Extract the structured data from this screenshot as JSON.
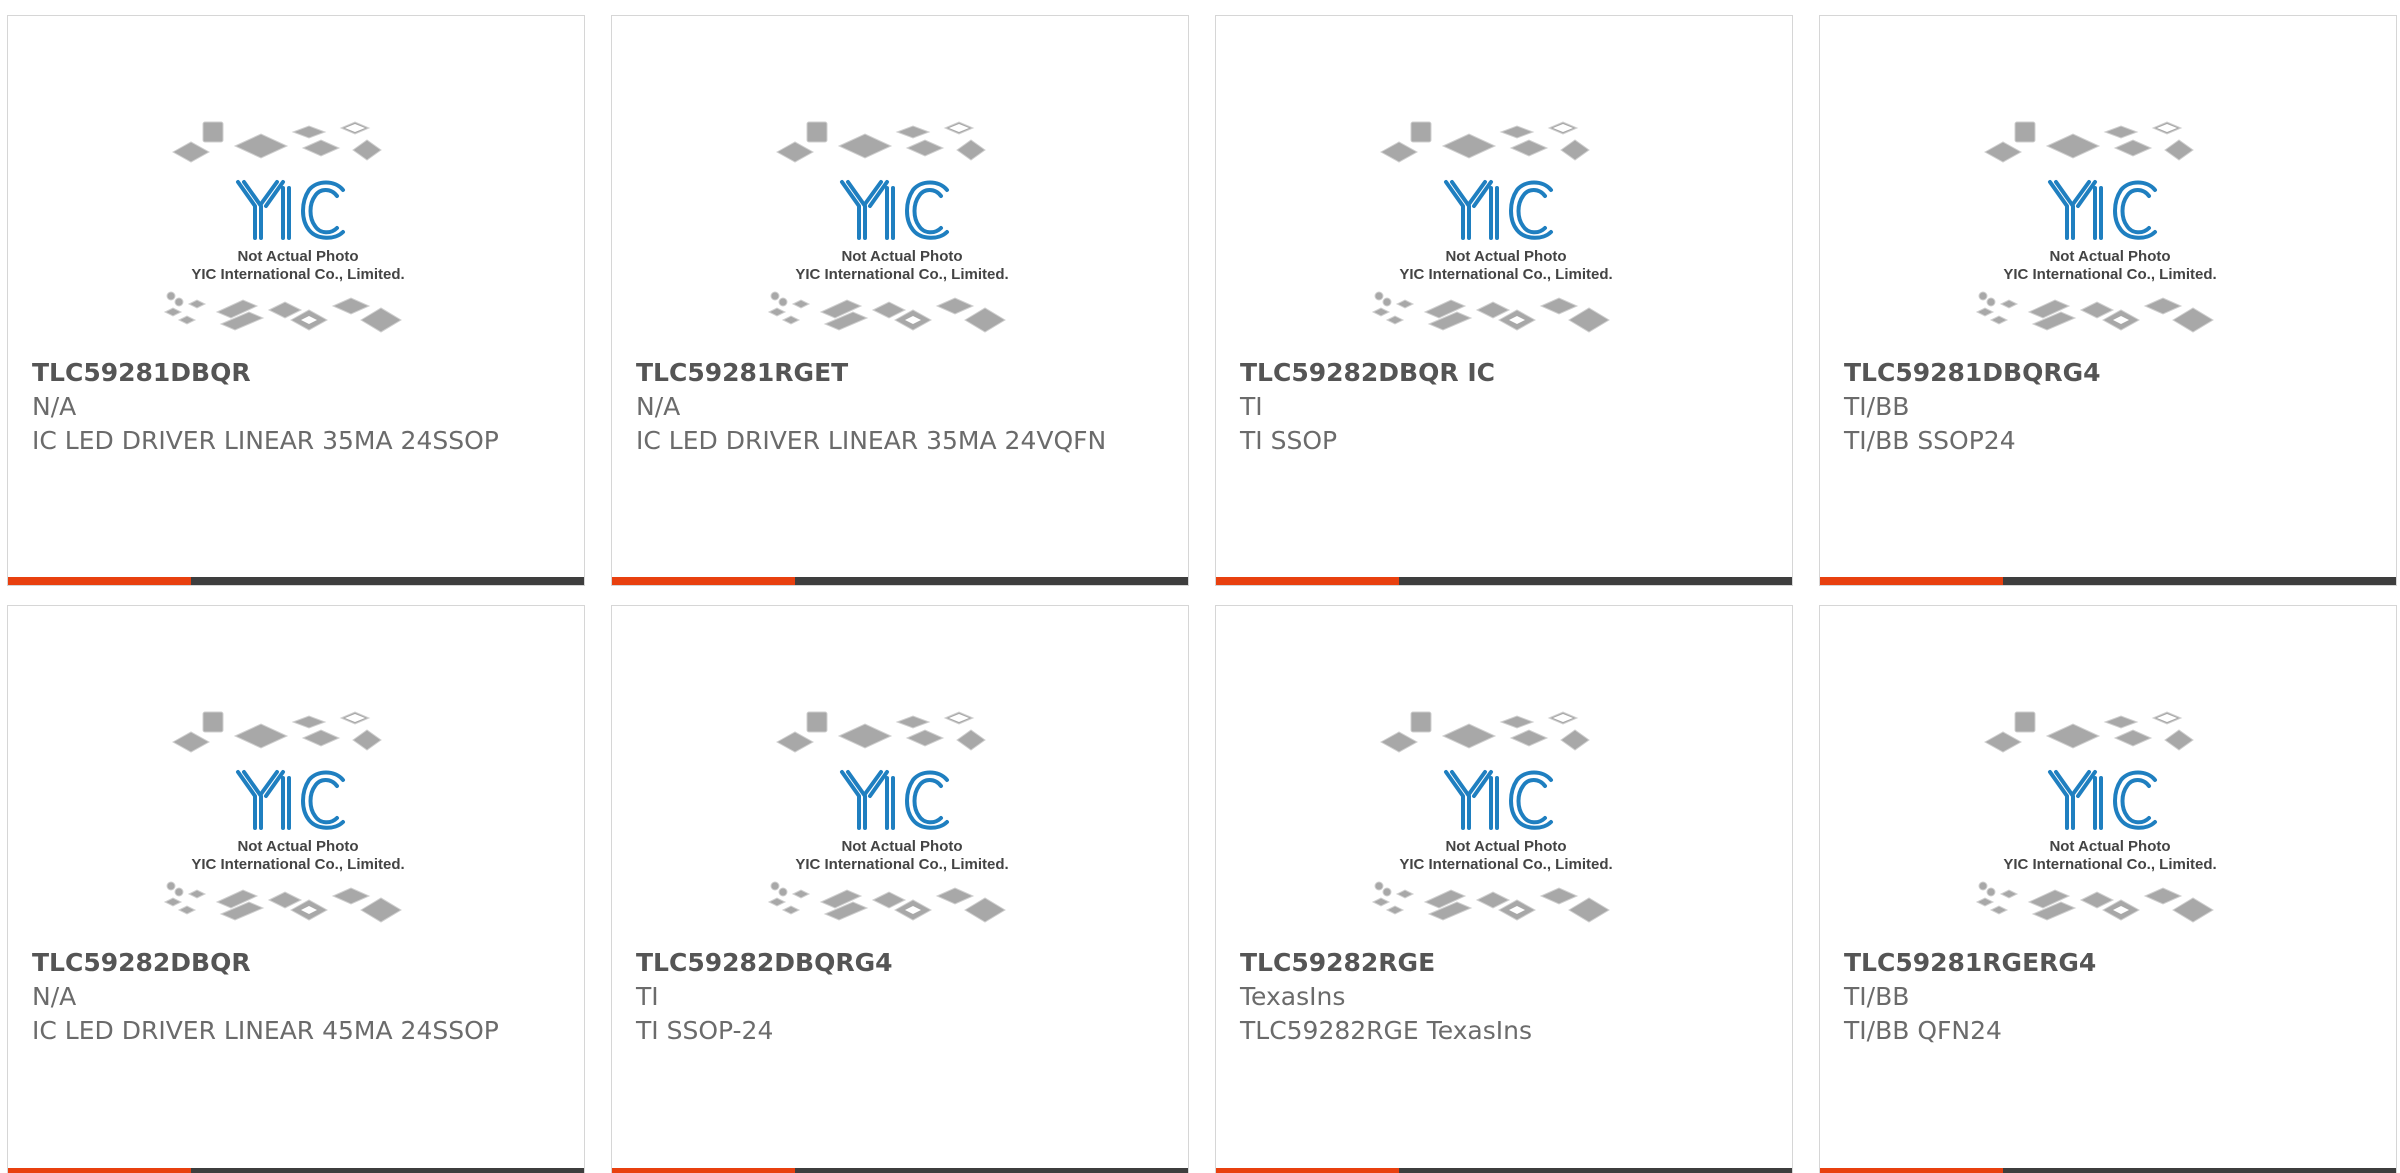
{
  "watermark": {
    "line1": "Not Actual Photo",
    "line2": "YIC International Co., Limited.",
    "logo_text": "YIC",
    "accent_color": "#e8400f",
    "bar_color": "#3e3e3e",
    "logo_color": "#1f7fc0"
  },
  "products": [
    {
      "part": "TLC59281DBQR",
      "brand": "N/A",
      "desc": "IC LED DRIVER LINEAR 35MA 24SSOP"
    },
    {
      "part": "TLC59281RGET",
      "brand": "N/A",
      "desc": "IC LED DRIVER LINEAR 35MA 24VQFN"
    },
    {
      "part": "TLC59282DBQR IC",
      "brand": "TI",
      "desc": "TI SSOP"
    },
    {
      "part": "TLC59281DBQRG4",
      "brand": "TI/BB",
      "desc": "TI/BB SSOP24"
    },
    {
      "part": "TLC59282DBQR",
      "brand": "N/A",
      "desc": "IC LED DRIVER LINEAR 45MA 24SSOP"
    },
    {
      "part": "TLC59282DBQRG4",
      "brand": "TI",
      "desc": "TI SSOP-24"
    },
    {
      "part": "TLC59282RGE",
      "brand": "TexasIns",
      "desc": "TLC59282RGE TexasIns"
    },
    {
      "part": "TLC59281RGERG4",
      "brand": "TI/BB",
      "desc": "TI/BB QFN24"
    }
  ]
}
